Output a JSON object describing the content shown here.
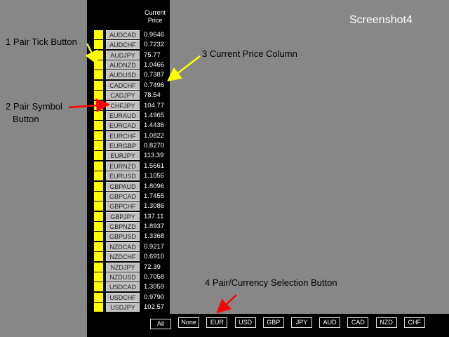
{
  "screenshot_label": "Screenshot4",
  "header": {
    "line1": "Current",
    "line2": "Price"
  },
  "pairs": [
    {
      "symbol": "AUDCAD",
      "price": "0.9646"
    },
    {
      "symbol": "AUDCHF",
      "price": "0.7232"
    },
    {
      "symbol": "AUDJPY",
      "price": "75.77"
    },
    {
      "symbol": "AUDNZD",
      "price": "1.0466"
    },
    {
      "symbol": "AUDUSD",
      "price": "0.7387"
    },
    {
      "symbol": "CADCHF",
      "price": "0.7496"
    },
    {
      "symbol": "CADJPY",
      "price": "78.54"
    },
    {
      "symbol": "CHFJPY",
      "price": "104.77"
    },
    {
      "symbol": "EURAUD",
      "price": "1.4965"
    },
    {
      "symbol": "EURCAD",
      "price": "1.4436"
    },
    {
      "symbol": "EURCHF",
      "price": "1.0822"
    },
    {
      "symbol": "EURGBP",
      "price": "0.8270"
    },
    {
      "symbol": "EURJPY",
      "price": "113.39"
    },
    {
      "symbol": "EURNZD",
      "price": "1.5661"
    },
    {
      "symbol": "EURUSD",
      "price": "1.1055"
    },
    {
      "symbol": "GBPAUD",
      "price": "1.8096"
    },
    {
      "symbol": "GBPCAD",
      "price": "1.7455"
    },
    {
      "symbol": "GBPCHF",
      "price": "1.3086"
    },
    {
      "symbol": "GBPJPY",
      "price": "137.11"
    },
    {
      "symbol": "GBPNZD",
      "price": "1.8937"
    },
    {
      "symbol": "GBPUSD",
      "price": "1.3368"
    },
    {
      "symbol": "NZDCAD",
      "price": "0.9217"
    },
    {
      "symbol": "NZDCHF",
      "price": "0.6910"
    },
    {
      "symbol": "NZDJPY",
      "price": "72.39"
    },
    {
      "symbol": "NZDUSD",
      "price": "0.7058"
    },
    {
      "symbol": "USDCAD",
      "price": "1.3059"
    },
    {
      "symbol": "USDCHF",
      "price": "0.9790"
    },
    {
      "symbol": "USDJPY",
      "price": "102.57"
    }
  ],
  "currency_buttons": [
    "All",
    "None",
    "EUR",
    "USD",
    "GBP",
    "JPY",
    "AUD",
    "CAD",
    "NZD",
    "CHF"
  ],
  "annotations": {
    "a1": "1 Pair Tick Button",
    "a2_line1": "2 Pair Symbol",
    "a2_line2": "Button",
    "a3": "3 Current Price Column",
    "a4": "4 Pair/Currency Selection Button"
  },
  "colors": {
    "tick": "#ffff00",
    "panel": "#000000",
    "background": "#878787",
    "arrow_yellow": "#ffff00",
    "arrow_red": "#ff0000"
  }
}
